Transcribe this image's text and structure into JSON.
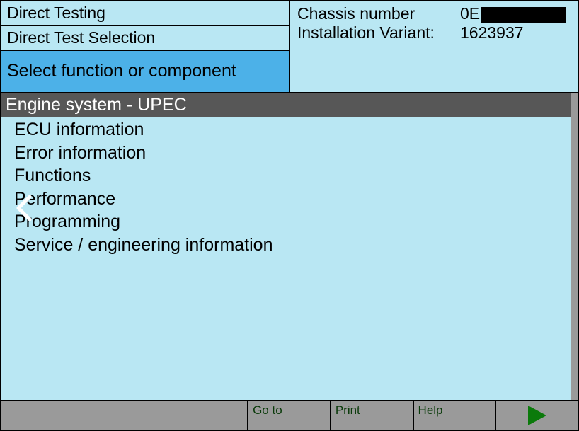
{
  "breadcrumbs": {
    "level1": "Direct Testing",
    "level2": "Direct Test Selection",
    "active": "Select function or component"
  },
  "header_info": {
    "chassis_label": "Chassis number",
    "chassis_value_prefix": "0E",
    "variant_label": "Installation Variant:",
    "variant_value": "1623937"
  },
  "section_title": "Engine system - UPEC",
  "functions": [
    "ECU information",
    "Error information",
    "Functions",
    "Performance",
    "Programming",
    "Service / engineering information"
  ],
  "footer": {
    "goto": "Go to",
    "print": "Print",
    "help": "Help"
  }
}
